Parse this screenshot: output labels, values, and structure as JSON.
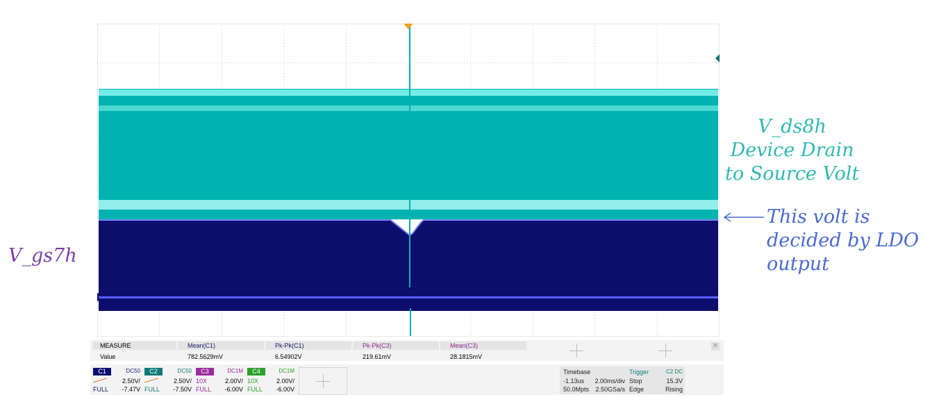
{
  "annotations": {
    "gs_label": "V_gs7h",
    "ds_line1": "V_ds8h",
    "ds_line2": "Device Drain",
    "ds_line3": "to Source Volt",
    "ldo_line1": "This volt is",
    "ldo_line2": "decided by LDO",
    "ldo_line3": "output"
  },
  "ch1_marker": "C1",
  "colors": {
    "ch1": "#0d0d6e",
    "ch1_edge": "#7d84ff",
    "ch2": "#00b3b0",
    "ch2_light": "#7ff2ef",
    "ch3": "#9b2b9c",
    "ch4": "#2aa12a",
    "trigger": "#f0a020",
    "annot_purple": "#7b3fa5",
    "annot_teal": "#30b8b0",
    "annot_blue": "#4a6ad0"
  },
  "measure": {
    "title": "MEASURE",
    "row_label": "Value",
    "params": [
      {
        "name": "Mean(C1)",
        "value": "782.5629mV"
      },
      {
        "name": "Pk-Pk(C1)",
        "value": "6.54902V"
      },
      {
        "name": "Pk-Pk(C3)",
        "value": "219.61mV"
      },
      {
        "name": "Mean(C3)",
        "value": "28.1815mV"
      }
    ]
  },
  "channels": [
    {
      "tag": "C1",
      "coupling": "DC50",
      "scale": "2.50V/",
      "offset": "-7.47V",
      "bw": "FULL",
      "probe": ""
    },
    {
      "tag": "C2",
      "coupling": "DC50",
      "scale": "2.50V/",
      "offset": "-7.50V",
      "bw": "FULL",
      "probe": ""
    },
    {
      "tag": "C3",
      "coupling": "DC1M",
      "scale": "2.00V/",
      "offset": "-6.00V",
      "bw": "FULL",
      "probe": "10X"
    },
    {
      "tag": "C4",
      "coupling": "DC1M",
      "scale": "2.00V/",
      "offset": "-6.00V",
      "bw": "FULL",
      "probe": "10X"
    }
  ],
  "timebase": {
    "title": "Timebase",
    "delay": "-1.13us",
    "div": "2.00ms/div",
    "points": "50.0Mpts",
    "rate": "2.50GSa/s"
  },
  "trigger": {
    "title": "Trigger",
    "source": "C2 DC",
    "mode": "Stop",
    "level": "15.3V",
    "type": "Edge",
    "slope": "Rising"
  }
}
